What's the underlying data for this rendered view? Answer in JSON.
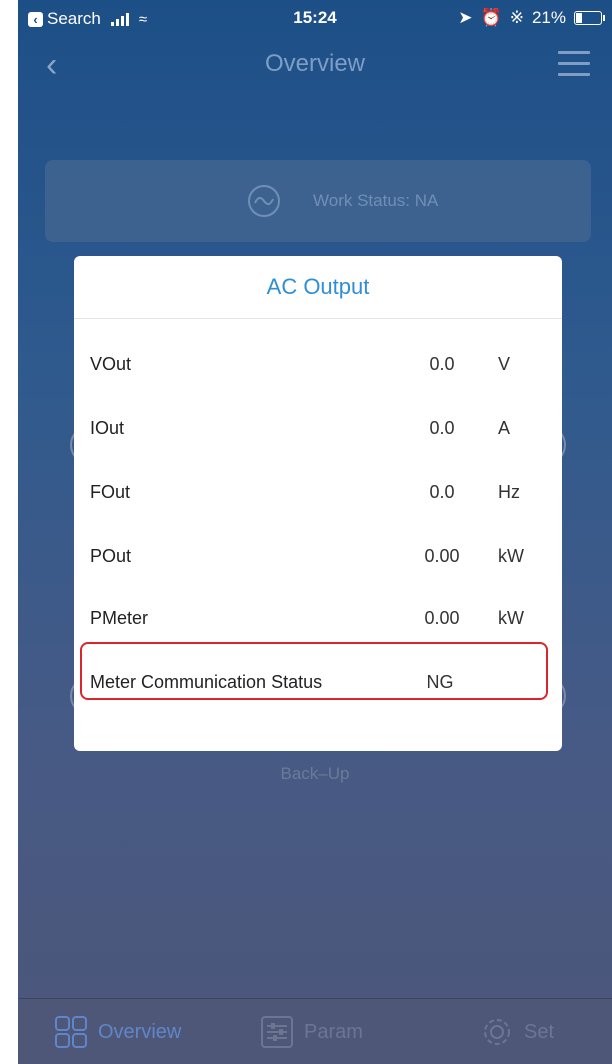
{
  "statusbar": {
    "back_app": "Search",
    "time": "15:24",
    "battery": "21%",
    "battery_level": 0.21
  },
  "navbar": {
    "title": "Overview",
    "back_icon": "chevron-left-icon",
    "menu_icon": "hamburger-menu-icon"
  },
  "work_status": {
    "label": "Work Status: NA",
    "icon": "sine-wave-icon"
  },
  "background": {
    "backup_label": "Back–Up"
  },
  "modal": {
    "title": "AC Output",
    "rows": [
      {
        "name": "VOut",
        "value": "0.0",
        "unit": "V"
      },
      {
        "name": "IOut",
        "value": "0.0",
        "unit": "A"
      },
      {
        "name": "FOut",
        "value": "0.0",
        "unit": "Hz"
      },
      {
        "name": "POut",
        "value": "0.00",
        "unit": "kW"
      },
      {
        "name": "PMeter",
        "value": "0.00",
        "unit": "kW"
      },
      {
        "name": "Meter Communication Status",
        "value": "NG",
        "unit": ""
      }
    ],
    "highlight_color": "#d9262d"
  },
  "tabbar": {
    "tabs": [
      {
        "label": "Overview",
        "icon": "grid-icon",
        "active": true
      },
      {
        "label": "Param",
        "icon": "sliders-icon",
        "active": false
      },
      {
        "label": "Set",
        "icon": "gear-icon",
        "active": false
      }
    ],
    "active_color": "#5f86c9"
  }
}
